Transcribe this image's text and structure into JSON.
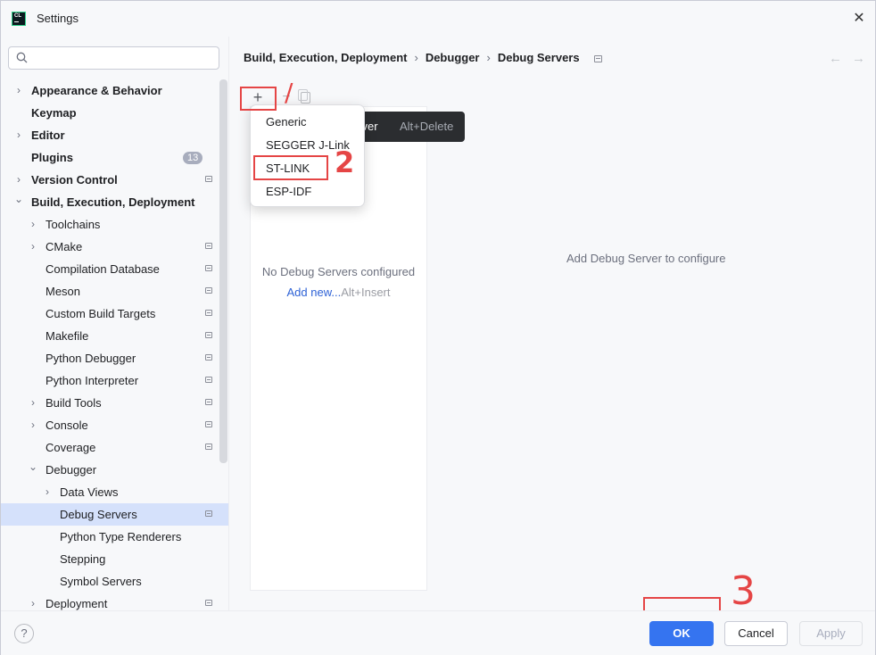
{
  "window": {
    "title": "Settings"
  },
  "search": {
    "placeholder": ""
  },
  "tree": [
    {
      "label": "Appearance & Behavior",
      "bold": true,
      "level": 0,
      "chevron": "right"
    },
    {
      "label": "Keymap",
      "bold": true,
      "level": 0,
      "chevron": ""
    },
    {
      "label": "Editor",
      "bold": true,
      "level": 0,
      "chevron": "right"
    },
    {
      "label": "Plugins",
      "bold": true,
      "level": 0,
      "chevron": "",
      "badge": "13"
    },
    {
      "label": "Version Control",
      "bold": true,
      "level": 0,
      "chevron": "right",
      "project": true
    },
    {
      "label": "Build, Execution, Deployment",
      "bold": true,
      "level": 0,
      "chevron": "down"
    },
    {
      "label": "Toolchains",
      "level": 1,
      "chevron": "right"
    },
    {
      "label": "CMake",
      "level": 1,
      "chevron": "right",
      "project": true
    },
    {
      "label": "Compilation Database",
      "level": 1,
      "chevron": "",
      "project": true
    },
    {
      "label": "Meson",
      "level": 1,
      "chevron": "",
      "project": true
    },
    {
      "label": "Custom Build Targets",
      "level": 1,
      "chevron": "",
      "project": true
    },
    {
      "label": "Makefile",
      "level": 1,
      "chevron": "",
      "project": true
    },
    {
      "label": "Python Debugger",
      "level": 1,
      "chevron": "",
      "project": true
    },
    {
      "label": "Python Interpreter",
      "level": 1,
      "chevron": "",
      "project": true
    },
    {
      "label": "Build Tools",
      "level": 1,
      "chevron": "right",
      "project": true
    },
    {
      "label": "Console",
      "level": 1,
      "chevron": "right",
      "project": true
    },
    {
      "label": "Coverage",
      "level": 1,
      "chevron": "",
      "project": true
    },
    {
      "label": "Debugger",
      "level": 1,
      "chevron": "down"
    },
    {
      "label": "Data Views",
      "level": 2,
      "chevron": "right"
    },
    {
      "label": "Debug Servers",
      "level": 2,
      "chevron": "",
      "project": true,
      "selected": true
    },
    {
      "label": "Python Type Renderers",
      "level": 2,
      "chevron": ""
    },
    {
      "label": "Stepping",
      "level": 2,
      "chevron": ""
    },
    {
      "label": "Symbol Servers",
      "level": 2,
      "chevron": ""
    },
    {
      "label": "Deployment",
      "level": 1,
      "chevron": "right",
      "project": true
    }
  ],
  "breadcrumb": [
    "Build, Execution, Deployment",
    "Debugger",
    "Debug Servers"
  ],
  "nav": {
    "back": "←",
    "forward": "→"
  },
  "toolbar": {
    "add": "+",
    "remove": "−"
  },
  "list": {
    "empty_text": "No Debug Servers configured",
    "add_new_link": "Add new...",
    "add_new_shortcut": "Alt+Insert"
  },
  "config_hint": "Add Debug Server to configure",
  "tooltip": {
    "text": "erver",
    "shortcut": "Alt+Delete"
  },
  "popup_menu": [
    "Generic",
    "SEGGER J-Link",
    "ST-LINK",
    "ESP-IDF"
  ],
  "annotations": [
    "/",
    "2",
    "3"
  ],
  "buttons": {
    "help": "?",
    "ok": "OK",
    "cancel": "Cancel",
    "apply": "Apply"
  },
  "colors": {
    "accent": "#3574f0",
    "annotation": "#e54545",
    "selection": "#d5e1fb",
    "link": "#2e62d6"
  }
}
